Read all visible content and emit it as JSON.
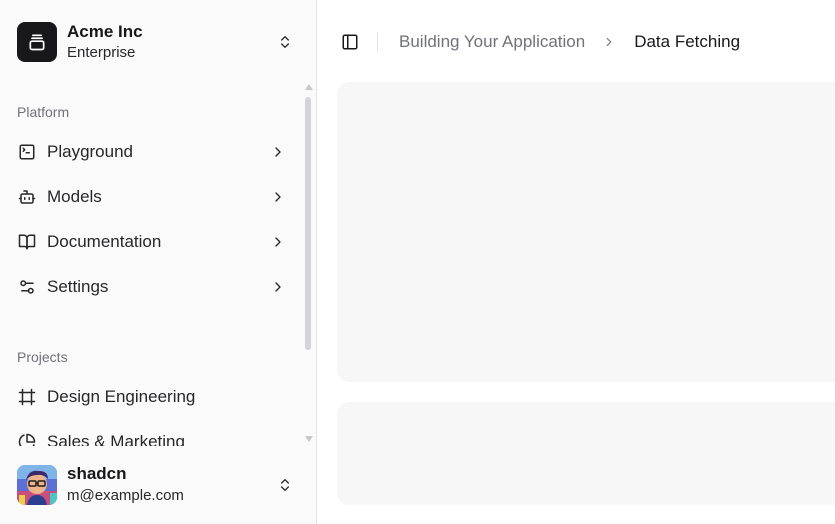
{
  "team": {
    "name": "Acme Inc",
    "plan": "Enterprise"
  },
  "nav": {
    "platform_label": "Platform",
    "items": [
      {
        "label": "Playground",
        "icon": "terminal-square-icon"
      },
      {
        "label": "Models",
        "icon": "bot-icon"
      },
      {
        "label": "Documentation",
        "icon": "book-open-icon"
      },
      {
        "label": "Settings",
        "icon": "settings-sliders-icon"
      }
    ],
    "projects_label": "Projects",
    "projects": [
      {
        "label": "Design Engineering",
        "icon": "frame-icon"
      },
      {
        "label": "Sales & Marketing",
        "icon": "pie-chart-icon"
      }
    ]
  },
  "user": {
    "name": "shadcn",
    "email": "m@example.com"
  },
  "breadcrumb": {
    "parent": "Building Your Application",
    "current": "Data Fetching"
  },
  "colors": {
    "sidebar_bg": "#fafafa",
    "placeholder_bg": "#f4f4f5",
    "muted_text": "#71717a",
    "foreground": "#18181b"
  }
}
